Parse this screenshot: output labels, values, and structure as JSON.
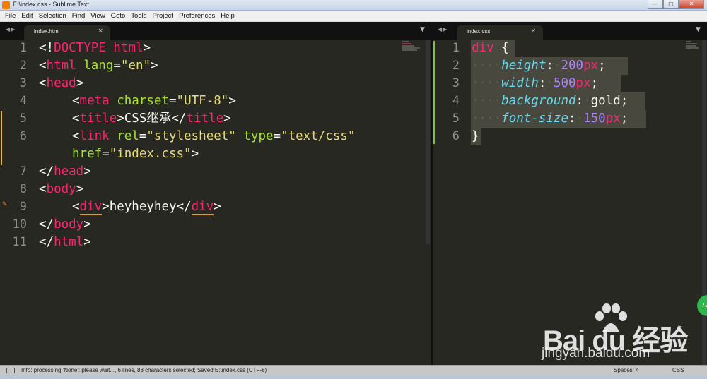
{
  "window": {
    "title": "E:\\index.css - Sublime Text"
  },
  "menu": [
    "File",
    "Edit",
    "Selection",
    "Find",
    "View",
    "Goto",
    "Tools",
    "Project",
    "Preferences",
    "Help"
  ],
  "left_pane": {
    "tab_label": "index.html",
    "close_glyph": "×",
    "line_numbers": [
      "1",
      "2",
      "3",
      "4",
      "5",
      "6",
      "7",
      "8",
      "9",
      "10",
      "11"
    ],
    "lines": {
      "l1": {
        "p1": "<!",
        "p2": "DOCTYPE",
        "p3": " html",
        "p4": ">"
      },
      "l2": {
        "p1": "<",
        "p2": "html",
        "p3": " lang",
        "p4": "=",
        "p5": "\"en\"",
        "p6": ">"
      },
      "l3": {
        "p1": "<",
        "p2": "head",
        "p3": ">"
      },
      "l4": {
        "p1": "<",
        "p2": "meta",
        "p3": " charset",
        "p4": "=",
        "p5": "\"UTF-8\"",
        "p6": ">"
      },
      "l5": {
        "p1": "<",
        "p2": "title",
        "p3": ">CSS继承</",
        "p4": "title",
        "p5": ">"
      },
      "l6": {
        "p1": "<",
        "p2": "link",
        "p3": " rel",
        "p4": "=",
        "p5": "\"stylesheet\"",
        "p6": " type",
        "p7": "=",
        "p8": "\"text/css\""
      },
      "l6b": {
        "p1": "href",
        "p2": "=",
        "p3": "\"index.css\"",
        "p4": ">"
      },
      "l7": {
        "p1": "</",
        "p2": "head",
        "p3": ">"
      },
      "l8": {
        "p1": "<",
        "p2": "body",
        "p3": ">"
      },
      "l9": {
        "p1": "<",
        "p2": "div",
        "p3": ">heyheyhey</",
        "p4": "div",
        "p5": ">"
      },
      "l10": {
        "p1": "</",
        "p2": "body",
        "p3": ">"
      },
      "l11": {
        "p1": "</",
        "p2": "html",
        "p3": ">"
      }
    }
  },
  "right_pane": {
    "tab_label": "index.css",
    "close_glyph": "×",
    "line_numbers": [
      "1",
      "2",
      "3",
      "4",
      "5",
      "6"
    ],
    "lines": {
      "l1": {
        "sel": "div",
        "rest": " {"
      },
      "l2": {
        "ws": "····",
        "prop": "height",
        "colon": ":",
        "ws2": "·",
        "num": "200",
        "unit": "px",
        "semi": ";"
      },
      "l3": {
        "ws": "····",
        "prop": "width",
        "colon": ":",
        "ws2": "·",
        "num": "500",
        "unit": "px",
        "semi": ";"
      },
      "l4": {
        "ws": "····",
        "prop": "background",
        "colon": ":",
        "ws2": "·",
        "val": "gold",
        "semi": ";"
      },
      "l5": {
        "ws": "····",
        "prop": "font-size",
        "colon": ":",
        "ws2": "·",
        "num": "150",
        "unit": "px",
        "semi": ";"
      },
      "l6": {
        "brace": "}"
      }
    }
  },
  "statusbar": {
    "message": "Info: processing 'None': please wait..., 6 lines, 88 characters selected; Saved E:\\index.css (UTF-8)",
    "spaces": "Spaces: 4",
    "syntax": "CSS"
  },
  "watermark": {
    "brand": "Bai du 经验",
    "site": "jingyan.baidu.com"
  },
  "badge": {
    "text": "72"
  },
  "colors": {
    "background": "#272822",
    "tag": "#f92672",
    "attribute": "#a6e22e",
    "string": "#e6db74",
    "property": "#66d9ef",
    "number": "#ae81ff"
  },
  "icons": [
    "tab-nav-arrows-icon",
    "tab-dropdown-icon",
    "bookmark-icon",
    "panel-toggle-icon"
  ]
}
